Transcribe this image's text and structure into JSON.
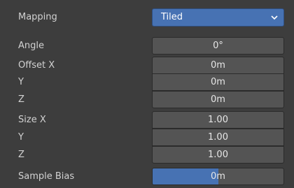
{
  "mapping": {
    "label": "Mapping",
    "selected": "Tiled"
  },
  "angle": {
    "label": "Angle",
    "value": "0°"
  },
  "offset": {
    "x_label": "Offset X",
    "x_value": "0m",
    "y_label": "Y",
    "y_value": "0m",
    "z_label": "Z",
    "z_value": "0m"
  },
  "size": {
    "x_label": "Size X",
    "x_value": "1.00",
    "y_label": "Y",
    "y_value": "1.00",
    "z_label": "Z",
    "z_value": "1.00"
  },
  "sample_bias": {
    "label": "Sample Bias",
    "value": "0m",
    "fill_fraction": 0.5
  },
  "colors": {
    "panel_bg": "#3d3d3d",
    "field_bg": "#545454",
    "accent": "#4772b3"
  },
  "icons": {
    "dropdown": "chevron-down-icon"
  }
}
